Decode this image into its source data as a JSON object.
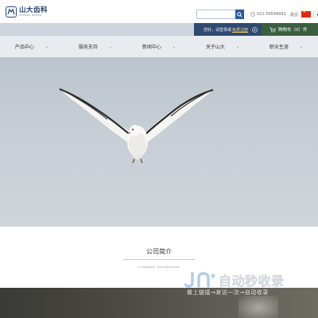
{
  "header": {
    "logo_cn": "山大齿科",
    "logo_en": "SHANDA DENTAL",
    "search_placeholder": "",
    "phone": "021-59549091",
    "language_label": "语言:"
  },
  "topbar": {
    "greeting": "您好，请",
    "login": "登录",
    "or": "或",
    "register": "免费注册",
    "cart_label": "购物车（0）件"
  },
  "nav": {
    "items": [
      {
        "label": "产品中心"
      },
      {
        "label": "服务支持"
      },
      {
        "label": "新闻中心"
      },
      {
        "label": "关于山大"
      },
      {
        "label": "职业生涯"
      }
    ]
  },
  "about": {
    "title": "公司简介",
    "subtitle": "Company Introduction"
  },
  "watermark": {
    "main": "自动秒收录",
    "sub": "做上链接→来访一次→自动收录"
  },
  "colors": {
    "brand_blue": "#2a5aa3",
    "topbar_dark": "#2e4a72",
    "cart_green": "#3a5f3e",
    "register_yellow": "#ffd86b"
  }
}
